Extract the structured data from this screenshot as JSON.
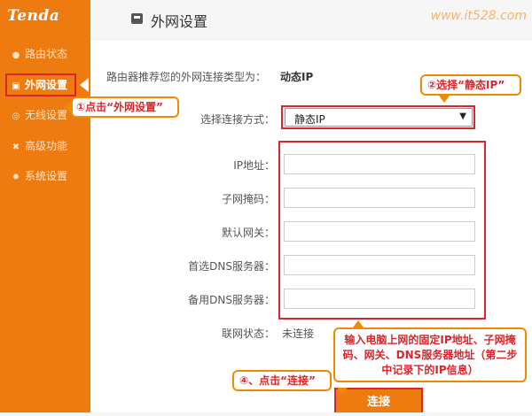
{
  "brand": {
    "logo": "Tenda"
  },
  "watermark": "www.it528.com",
  "sidebar": {
    "items": [
      {
        "label": "路由状态",
        "icon": "circle-icon",
        "glyph": "●"
      },
      {
        "label": "外网设置",
        "icon": "router-icon",
        "glyph": "▣"
      },
      {
        "label": "无线设置",
        "icon": "wifi-icon",
        "glyph": "◎"
      },
      {
        "label": "高级功能",
        "icon": "tools-icon",
        "glyph": "✖"
      },
      {
        "label": "系统设置",
        "icon": "gear-icon",
        "glyph": "✹"
      }
    ]
  },
  "page": {
    "title": "外网设置"
  },
  "detect": {
    "label": "路由器推荐您的外网连接类型为：",
    "value": "动态IP"
  },
  "conn": {
    "label": "选择连接方式：",
    "selected": "静态IP"
  },
  "fields": [
    {
      "label": "IP地址：",
      "value": ""
    },
    {
      "label": "子网掩码：",
      "value": ""
    },
    {
      "label": "默认网关：",
      "value": ""
    },
    {
      "label": "首选DNS服务器：",
      "value": ""
    },
    {
      "label": "备用DNS服务器：",
      "value": ""
    }
  ],
  "status": {
    "label": "联网状态：",
    "value": "未连接"
  },
  "connect_label": "连接",
  "callouts": {
    "step1": "①点击“外网设置”",
    "step2": "②选择“静态IP”",
    "step3": "输入电脑上网的固定IP地址、子网掩码、网关、DNS服务器地址（第二步中记录下的IP信息）",
    "step4": "④、点击“连接”"
  },
  "colors": {
    "accent": "#ee7b10",
    "highlight": "#d8262c",
    "callout_border": "#f08a00"
  }
}
